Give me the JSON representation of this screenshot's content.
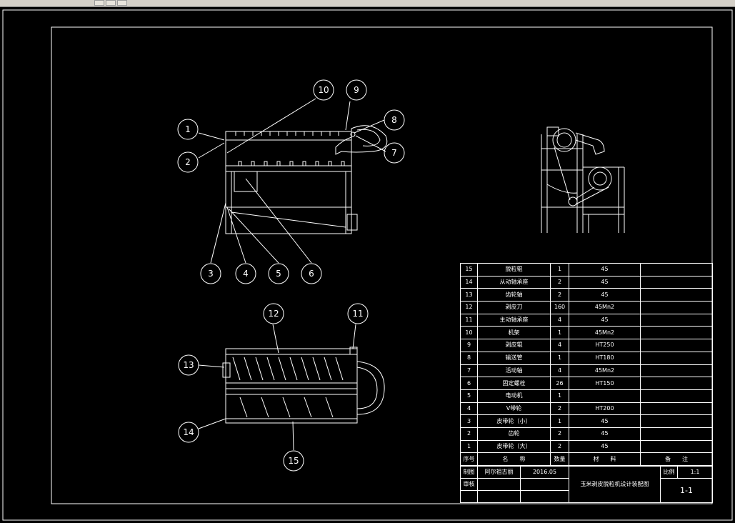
{
  "callouts": [
    "1",
    "2",
    "3",
    "4",
    "5",
    "6",
    "7",
    "8",
    "9",
    "10",
    "11",
    "12",
    "13",
    "14",
    "15"
  ],
  "parts": [
    {
      "no": "15",
      "name": "脱粒辊",
      "qty": "1",
      "material": "45",
      "remark": ""
    },
    {
      "no": "14",
      "name": "从动轴承座",
      "qty": "2",
      "material": "45",
      "remark": ""
    },
    {
      "no": "13",
      "name": "齿轮轴",
      "qty": "2",
      "material": "45",
      "remark": ""
    },
    {
      "no": "12",
      "name": "剥皮刀",
      "qty": "160",
      "material": "45Mn2",
      "remark": ""
    },
    {
      "no": "11",
      "name": "主动轴承座",
      "qty": "4",
      "material": "45",
      "remark": ""
    },
    {
      "no": "10",
      "name": "机架",
      "qty": "1",
      "material": "45Mn2",
      "remark": ""
    },
    {
      "no": "9",
      "name": "剥皮辊",
      "qty": "4",
      "material": "HT250",
      "remark": ""
    },
    {
      "no": "8",
      "name": "输送管",
      "qty": "1",
      "material": "HT180",
      "remark": ""
    },
    {
      "no": "7",
      "name": "活动轴",
      "qty": "4",
      "material": "45Mn2",
      "remark": ""
    },
    {
      "no": "6",
      "name": "固定螺栓",
      "qty": "26",
      "material": "HT150",
      "remark": ""
    },
    {
      "no": "5",
      "name": "电动机",
      "qty": "1",
      "material": "",
      "remark": ""
    },
    {
      "no": "4",
      "name": "V带轮",
      "qty": "2",
      "material": "HT200",
      "remark": ""
    },
    {
      "no": "3",
      "name": "皮带轮（小）",
      "qty": "1",
      "material": "45",
      "remark": ""
    },
    {
      "no": "2",
      "name": "齿轮",
      "qty": "2",
      "material": "45",
      "remark": ""
    },
    {
      "no": "1",
      "name": "皮带轮（大）",
      "qty": "2",
      "material": "45",
      "remark": ""
    }
  ],
  "headers": {
    "no": "序号",
    "name": "名　　称",
    "qty": "数量",
    "material": "材　　料",
    "remark": "备　　注"
  },
  "title_block": {
    "drawn_label": "制图",
    "drawn_by": "阿尔祖古丽",
    "date": "2016.05",
    "review_label": "审核",
    "drawing_title": "玉米剥皮脱粒机设计装配图",
    "scale_label": "比例",
    "scale": "1:1",
    "sheet": "1-1"
  },
  "colors": {
    "background": "#000000",
    "lines": "#ffffff",
    "toolbar": "#d4d0c8"
  }
}
